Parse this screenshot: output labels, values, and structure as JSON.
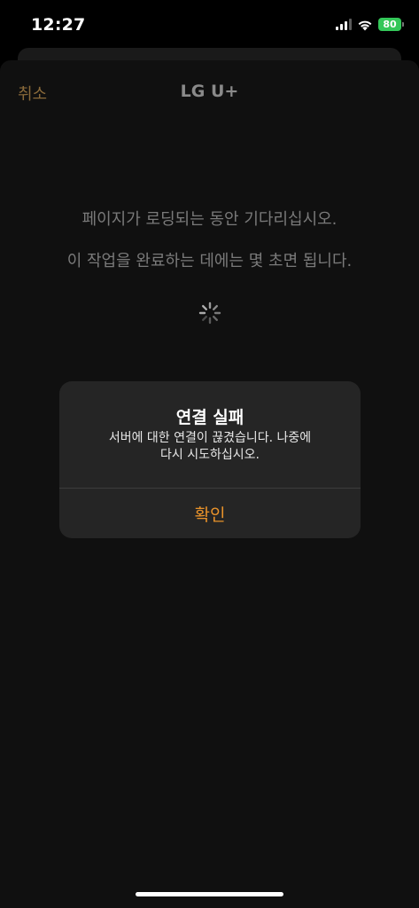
{
  "status_bar": {
    "time": "12:27",
    "battery": "80"
  },
  "nav": {
    "cancel_label": "취소",
    "title": "LG U+"
  },
  "loading": {
    "line1": "페이지가 로딩되는 동안 기다리십시오.",
    "line2": "이 작업을 완료하는 데에는 몇 초면 됩니다."
  },
  "alert": {
    "title": "연결 실패",
    "message_line1": "서버에 대한 연결이 끊겼습니다.  나중에",
    "message_line2": "다시 시도하십시오.",
    "button_label": "확인"
  },
  "colors": {
    "accent": "#e8922a",
    "battery": "#34c759"
  }
}
